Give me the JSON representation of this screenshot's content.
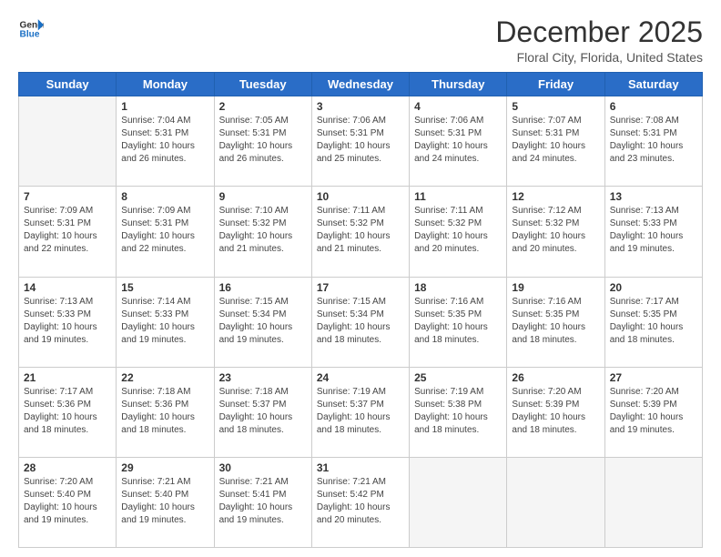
{
  "header": {
    "logo_line1": "General",
    "logo_line2": "Blue",
    "month": "December 2025",
    "location": "Floral City, Florida, United States"
  },
  "days_of_week": [
    "Sunday",
    "Monday",
    "Tuesday",
    "Wednesday",
    "Thursday",
    "Friday",
    "Saturday"
  ],
  "weeks": [
    [
      {
        "day": "",
        "empty": true
      },
      {
        "day": "1",
        "sunrise": "7:04 AM",
        "sunset": "5:31 PM",
        "daylight": "10 hours and 26 minutes."
      },
      {
        "day": "2",
        "sunrise": "7:05 AM",
        "sunset": "5:31 PM",
        "daylight": "10 hours and 26 minutes."
      },
      {
        "day": "3",
        "sunrise": "7:06 AM",
        "sunset": "5:31 PM",
        "daylight": "10 hours and 25 minutes."
      },
      {
        "day": "4",
        "sunrise": "7:06 AM",
        "sunset": "5:31 PM",
        "daylight": "10 hours and 24 minutes."
      },
      {
        "day": "5",
        "sunrise": "7:07 AM",
        "sunset": "5:31 PM",
        "daylight": "10 hours and 24 minutes."
      },
      {
        "day": "6",
        "sunrise": "7:08 AM",
        "sunset": "5:31 PM",
        "daylight": "10 hours and 23 minutes."
      }
    ],
    [
      {
        "day": "7",
        "sunrise": "7:09 AM",
        "sunset": "5:31 PM",
        "daylight": "10 hours and 22 minutes."
      },
      {
        "day": "8",
        "sunrise": "7:09 AM",
        "sunset": "5:31 PM",
        "daylight": "10 hours and 22 minutes."
      },
      {
        "day": "9",
        "sunrise": "7:10 AM",
        "sunset": "5:32 PM",
        "daylight": "10 hours and 21 minutes."
      },
      {
        "day": "10",
        "sunrise": "7:11 AM",
        "sunset": "5:32 PM",
        "daylight": "10 hours and 21 minutes."
      },
      {
        "day": "11",
        "sunrise": "7:11 AM",
        "sunset": "5:32 PM",
        "daylight": "10 hours and 20 minutes."
      },
      {
        "day": "12",
        "sunrise": "7:12 AM",
        "sunset": "5:32 PM",
        "daylight": "10 hours and 20 minutes."
      },
      {
        "day": "13",
        "sunrise": "7:13 AM",
        "sunset": "5:33 PM",
        "daylight": "10 hours and 19 minutes."
      }
    ],
    [
      {
        "day": "14",
        "sunrise": "7:13 AM",
        "sunset": "5:33 PM",
        "daylight": "10 hours and 19 minutes."
      },
      {
        "day": "15",
        "sunrise": "7:14 AM",
        "sunset": "5:33 PM",
        "daylight": "10 hours and 19 minutes."
      },
      {
        "day": "16",
        "sunrise": "7:15 AM",
        "sunset": "5:34 PM",
        "daylight": "10 hours and 19 minutes."
      },
      {
        "day": "17",
        "sunrise": "7:15 AM",
        "sunset": "5:34 PM",
        "daylight": "10 hours and 18 minutes."
      },
      {
        "day": "18",
        "sunrise": "7:16 AM",
        "sunset": "5:35 PM",
        "daylight": "10 hours and 18 minutes."
      },
      {
        "day": "19",
        "sunrise": "7:16 AM",
        "sunset": "5:35 PM",
        "daylight": "10 hours and 18 minutes."
      },
      {
        "day": "20",
        "sunrise": "7:17 AM",
        "sunset": "5:35 PM",
        "daylight": "10 hours and 18 minutes."
      }
    ],
    [
      {
        "day": "21",
        "sunrise": "7:17 AM",
        "sunset": "5:36 PM",
        "daylight": "10 hours and 18 minutes."
      },
      {
        "day": "22",
        "sunrise": "7:18 AM",
        "sunset": "5:36 PM",
        "daylight": "10 hours and 18 minutes."
      },
      {
        "day": "23",
        "sunrise": "7:18 AM",
        "sunset": "5:37 PM",
        "daylight": "10 hours and 18 minutes."
      },
      {
        "day": "24",
        "sunrise": "7:19 AM",
        "sunset": "5:37 PM",
        "daylight": "10 hours and 18 minutes."
      },
      {
        "day": "25",
        "sunrise": "7:19 AM",
        "sunset": "5:38 PM",
        "daylight": "10 hours and 18 minutes."
      },
      {
        "day": "26",
        "sunrise": "7:20 AM",
        "sunset": "5:39 PM",
        "daylight": "10 hours and 18 minutes."
      },
      {
        "day": "27",
        "sunrise": "7:20 AM",
        "sunset": "5:39 PM",
        "daylight": "10 hours and 19 minutes."
      }
    ],
    [
      {
        "day": "28",
        "sunrise": "7:20 AM",
        "sunset": "5:40 PM",
        "daylight": "10 hours and 19 minutes."
      },
      {
        "day": "29",
        "sunrise": "7:21 AM",
        "sunset": "5:40 PM",
        "daylight": "10 hours and 19 minutes."
      },
      {
        "day": "30",
        "sunrise": "7:21 AM",
        "sunset": "5:41 PM",
        "daylight": "10 hours and 19 minutes."
      },
      {
        "day": "31",
        "sunrise": "7:21 AM",
        "sunset": "5:42 PM",
        "daylight": "10 hours and 20 minutes."
      },
      {
        "day": "",
        "empty": true
      },
      {
        "day": "",
        "empty": true
      },
      {
        "day": "",
        "empty": true
      }
    ]
  ]
}
